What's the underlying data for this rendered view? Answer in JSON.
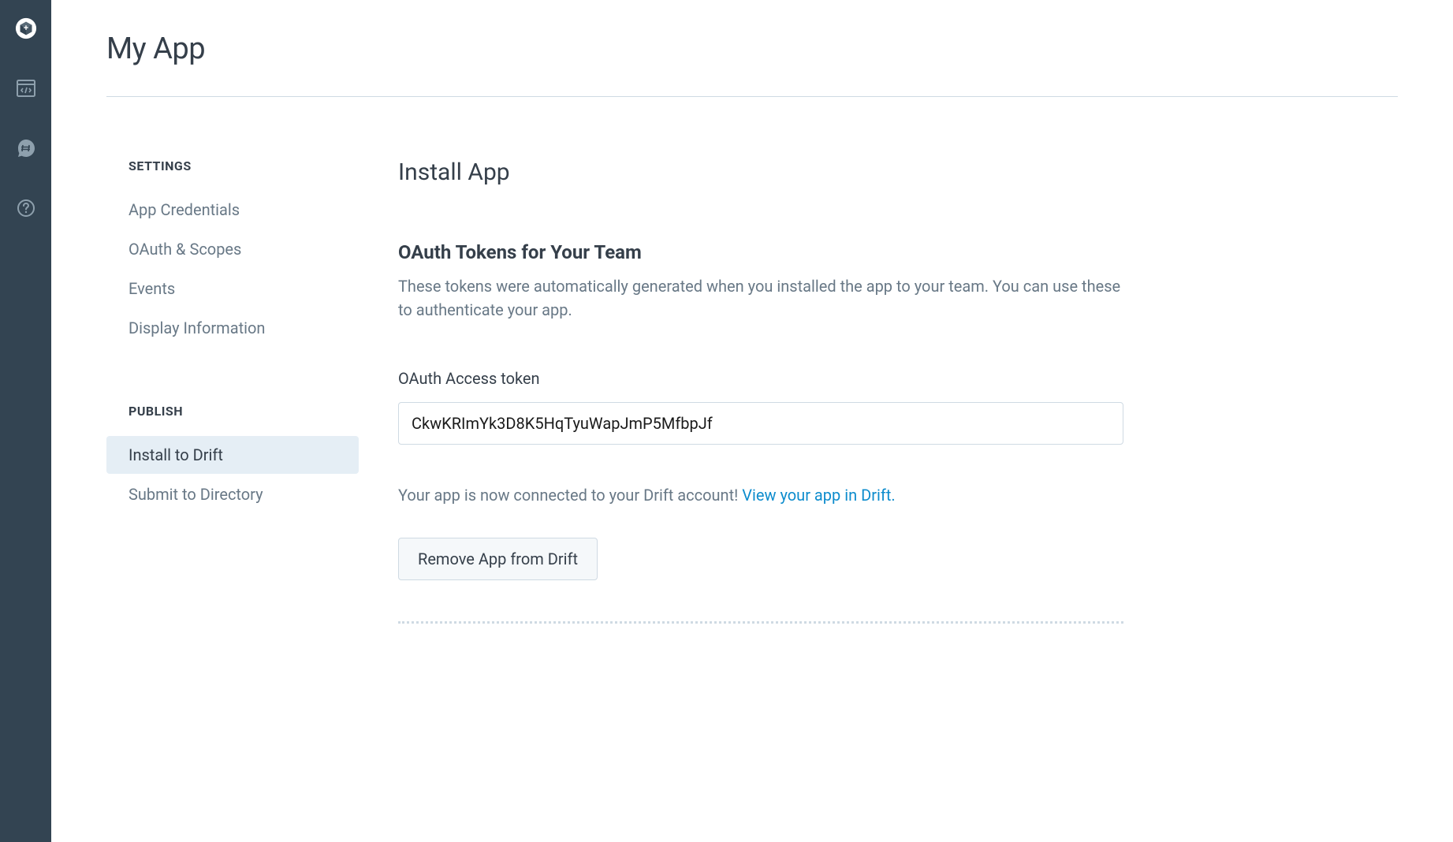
{
  "page": {
    "title": "My App"
  },
  "sidebar_menu": {
    "settings_label": "SETTINGS",
    "publish_label": "PUBLISH",
    "items": {
      "app_credentials": "App Credentials",
      "oauth_scopes": "OAuth & Scopes",
      "events": "Events",
      "display_information": "Display Information",
      "install_to_drift": "Install to Drift",
      "submit_to_directory": "Submit to Directory"
    }
  },
  "main": {
    "heading": "Install App",
    "oauth_section": {
      "title": "OAuth Tokens for Your Team",
      "description": "These tokens were automatically generated when you installed the app to your team. You can use these to authenticate your app."
    },
    "token": {
      "label": "OAuth Access token",
      "value": "CkwKRImYk3D8K5HqTyuWapJmP5MfbpJf"
    },
    "status": {
      "text": "Your app is now connected to your Drift account! ",
      "link_text": "View your app in Drift."
    },
    "remove_button": "Remove App from Drift"
  }
}
